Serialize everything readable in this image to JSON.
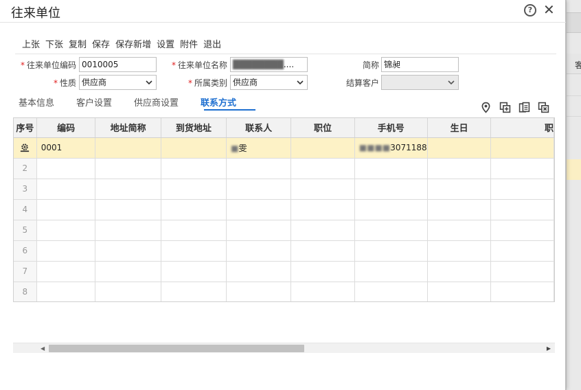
{
  "window": {
    "title": "往来单位"
  },
  "toolbar": [
    "上张",
    "下张",
    "复制",
    "保存",
    "保存新增",
    "设置",
    "附件",
    "退出"
  ],
  "form": {
    "code_label": "往来单位编码",
    "code_value": "0010005",
    "name_label": "往来单位名称",
    "name_value": "....",
    "short_label": "简称",
    "short_value": "锦昶",
    "nature_label": "性质",
    "nature_value": "供应商",
    "category_label": "所属类别",
    "category_value": "供应商",
    "settle_label": "结算客户",
    "settle_value": ""
  },
  "tabs": {
    "basic": "基本信息",
    "customer": "客户设置",
    "supplier": "供应商设置",
    "contact": "联系方式"
  },
  "icons": [
    "location-icon",
    "add-row-icon",
    "copy-row-icon",
    "delete-row-icon"
  ],
  "grid": {
    "headers": [
      "序号",
      "编码",
      "地址简称",
      "到货地址",
      "联系人",
      "职位",
      "手机号",
      "生日",
      "职"
    ],
    "row1": {
      "code": "0001",
      "contact": "雯",
      "mobile": "3071188"
    },
    "indices": [
      "2",
      "3",
      "4",
      "5",
      "6",
      "7",
      "8"
    ]
  },
  "background": {
    "header_fragment": "客"
  },
  "colors": {
    "accent": "#1e6fd0",
    "selected_row": "#fdf2c6",
    "required": "#e02020"
  }
}
